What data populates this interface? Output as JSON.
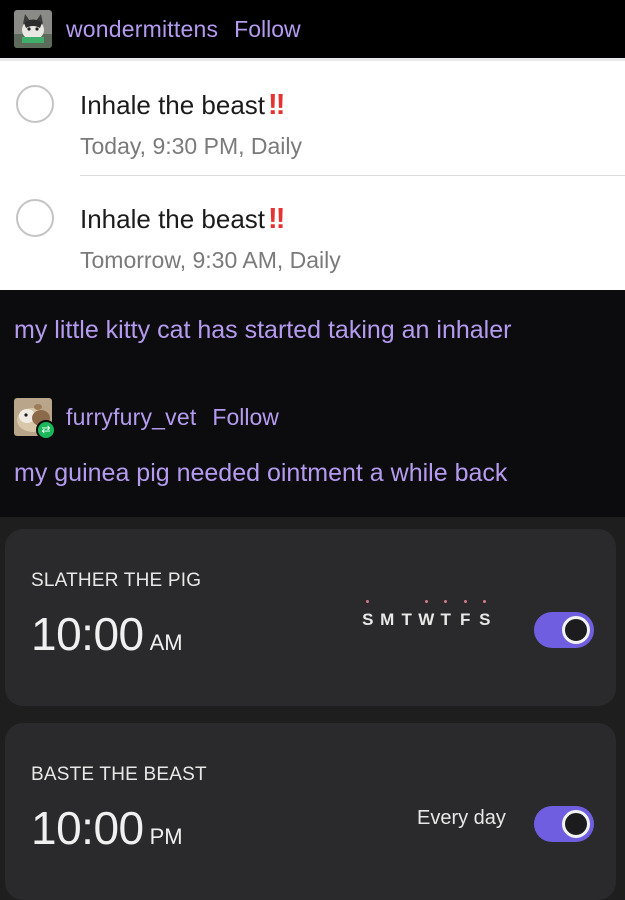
{
  "post1": {
    "username": "wondermittens",
    "follow_label": "Follow",
    "text": "my little kitty cat has started taking an inhaler"
  },
  "reminders": [
    {
      "title": "Inhale the beast",
      "emphasis": "!!",
      "subtitle": "Today, 9:30 PM, Daily"
    },
    {
      "title": "Inhale the beast",
      "emphasis": "!!",
      "subtitle": "Tomorrow, 9:30 AM, Daily"
    }
  ],
  "post2": {
    "username": "furryfury_vet",
    "follow_label": "Follow",
    "reblog_icon": "reblog-icon",
    "text": "my guinea pig needed ointment a while back"
  },
  "alarms": [
    {
      "label": "SLATHER THE PIG",
      "time": "10:00",
      "period": "AM",
      "days": [
        "S",
        "M",
        "T",
        "W",
        "T",
        "F",
        "S"
      ],
      "days_dotted": [
        true,
        false,
        false,
        true,
        true,
        true,
        true
      ],
      "toggle_on": true
    },
    {
      "label": "BASTE THE BEAST",
      "time": "10:00",
      "period": "PM",
      "recurrence": "Every day",
      "toggle_on": true
    }
  ],
  "colors": {
    "link_purple": "#b59bf0",
    "toggle_purple": "#6f5fe0",
    "priority_red": "#e53232",
    "reblog_green": "#19b85a"
  }
}
